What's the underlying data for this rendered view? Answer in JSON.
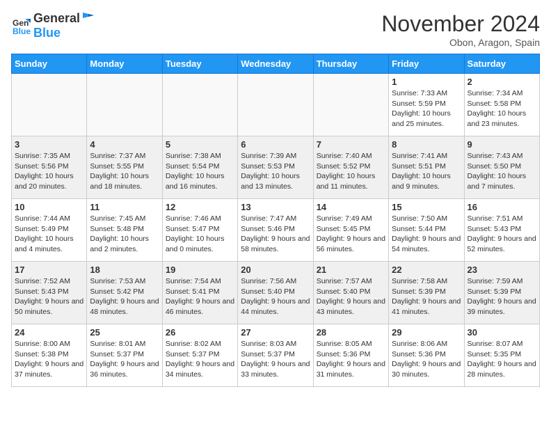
{
  "header": {
    "logo_line1": "General",
    "logo_line2": "Blue",
    "month": "November 2024",
    "location": "Obon, Aragon, Spain"
  },
  "weekdays": [
    "Sunday",
    "Monday",
    "Tuesday",
    "Wednesday",
    "Thursday",
    "Friday",
    "Saturday"
  ],
  "weeks": [
    [
      {
        "day": "",
        "info": ""
      },
      {
        "day": "",
        "info": ""
      },
      {
        "day": "",
        "info": ""
      },
      {
        "day": "",
        "info": ""
      },
      {
        "day": "",
        "info": ""
      },
      {
        "day": "1",
        "info": "Sunrise: 7:33 AM\nSunset: 5:59 PM\nDaylight: 10 hours and 25 minutes."
      },
      {
        "day": "2",
        "info": "Sunrise: 7:34 AM\nSunset: 5:58 PM\nDaylight: 10 hours and 23 minutes."
      }
    ],
    [
      {
        "day": "3",
        "info": "Sunrise: 7:35 AM\nSunset: 5:56 PM\nDaylight: 10 hours and 20 minutes."
      },
      {
        "day": "4",
        "info": "Sunrise: 7:37 AM\nSunset: 5:55 PM\nDaylight: 10 hours and 18 minutes."
      },
      {
        "day": "5",
        "info": "Sunrise: 7:38 AM\nSunset: 5:54 PM\nDaylight: 10 hours and 16 minutes."
      },
      {
        "day": "6",
        "info": "Sunrise: 7:39 AM\nSunset: 5:53 PM\nDaylight: 10 hours and 13 minutes."
      },
      {
        "day": "7",
        "info": "Sunrise: 7:40 AM\nSunset: 5:52 PM\nDaylight: 10 hours and 11 minutes."
      },
      {
        "day": "8",
        "info": "Sunrise: 7:41 AM\nSunset: 5:51 PM\nDaylight: 10 hours and 9 minutes."
      },
      {
        "day": "9",
        "info": "Sunrise: 7:43 AM\nSunset: 5:50 PM\nDaylight: 10 hours and 7 minutes."
      }
    ],
    [
      {
        "day": "10",
        "info": "Sunrise: 7:44 AM\nSunset: 5:49 PM\nDaylight: 10 hours and 4 minutes."
      },
      {
        "day": "11",
        "info": "Sunrise: 7:45 AM\nSunset: 5:48 PM\nDaylight: 10 hours and 2 minutes."
      },
      {
        "day": "12",
        "info": "Sunrise: 7:46 AM\nSunset: 5:47 PM\nDaylight: 10 hours and 0 minutes."
      },
      {
        "day": "13",
        "info": "Sunrise: 7:47 AM\nSunset: 5:46 PM\nDaylight: 9 hours and 58 minutes."
      },
      {
        "day": "14",
        "info": "Sunrise: 7:49 AM\nSunset: 5:45 PM\nDaylight: 9 hours and 56 minutes."
      },
      {
        "day": "15",
        "info": "Sunrise: 7:50 AM\nSunset: 5:44 PM\nDaylight: 9 hours and 54 minutes."
      },
      {
        "day": "16",
        "info": "Sunrise: 7:51 AM\nSunset: 5:43 PM\nDaylight: 9 hours and 52 minutes."
      }
    ],
    [
      {
        "day": "17",
        "info": "Sunrise: 7:52 AM\nSunset: 5:43 PM\nDaylight: 9 hours and 50 minutes."
      },
      {
        "day": "18",
        "info": "Sunrise: 7:53 AM\nSunset: 5:42 PM\nDaylight: 9 hours and 48 minutes."
      },
      {
        "day": "19",
        "info": "Sunrise: 7:54 AM\nSunset: 5:41 PM\nDaylight: 9 hours and 46 minutes."
      },
      {
        "day": "20",
        "info": "Sunrise: 7:56 AM\nSunset: 5:40 PM\nDaylight: 9 hours and 44 minutes."
      },
      {
        "day": "21",
        "info": "Sunrise: 7:57 AM\nSunset: 5:40 PM\nDaylight: 9 hours and 43 minutes."
      },
      {
        "day": "22",
        "info": "Sunrise: 7:58 AM\nSunset: 5:39 PM\nDaylight: 9 hours and 41 minutes."
      },
      {
        "day": "23",
        "info": "Sunrise: 7:59 AM\nSunset: 5:39 PM\nDaylight: 9 hours and 39 minutes."
      }
    ],
    [
      {
        "day": "24",
        "info": "Sunrise: 8:00 AM\nSunset: 5:38 PM\nDaylight: 9 hours and 37 minutes."
      },
      {
        "day": "25",
        "info": "Sunrise: 8:01 AM\nSunset: 5:37 PM\nDaylight: 9 hours and 36 minutes."
      },
      {
        "day": "26",
        "info": "Sunrise: 8:02 AM\nSunset: 5:37 PM\nDaylight: 9 hours and 34 minutes."
      },
      {
        "day": "27",
        "info": "Sunrise: 8:03 AM\nSunset: 5:37 PM\nDaylight: 9 hours and 33 minutes."
      },
      {
        "day": "28",
        "info": "Sunrise: 8:05 AM\nSunset: 5:36 PM\nDaylight: 9 hours and 31 minutes."
      },
      {
        "day": "29",
        "info": "Sunrise: 8:06 AM\nSunset: 5:36 PM\nDaylight: 9 hours and 30 minutes."
      },
      {
        "day": "30",
        "info": "Sunrise: 8:07 AM\nSunset: 5:35 PM\nDaylight: 9 hours and 28 minutes."
      }
    ]
  ]
}
